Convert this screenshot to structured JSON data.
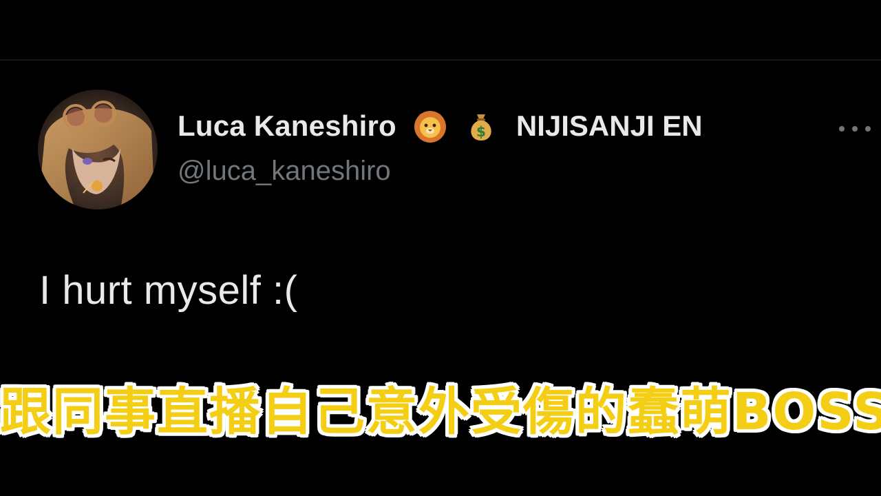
{
  "tweet": {
    "author": {
      "display_name": "Luca Kaneshiro",
      "name_emojis": [
        "lion-face-icon",
        "money-bag-icon"
      ],
      "affiliation": "NIJISANJI EN",
      "handle": "@luca_kaneshiro",
      "avatar": "avatar"
    },
    "text": "I hurt myself :(",
    "more_icon": "more-horizontal-icon"
  },
  "caption": {
    "text": "跟同事直播自己意外受傷的蠢萌BOSS",
    "fill_color": "#f4ce14",
    "outline_color": "#ffffff"
  },
  "colors": {
    "background": "#000000",
    "primary_text": "#e7e9ea",
    "secondary_text": "#71767b"
  }
}
